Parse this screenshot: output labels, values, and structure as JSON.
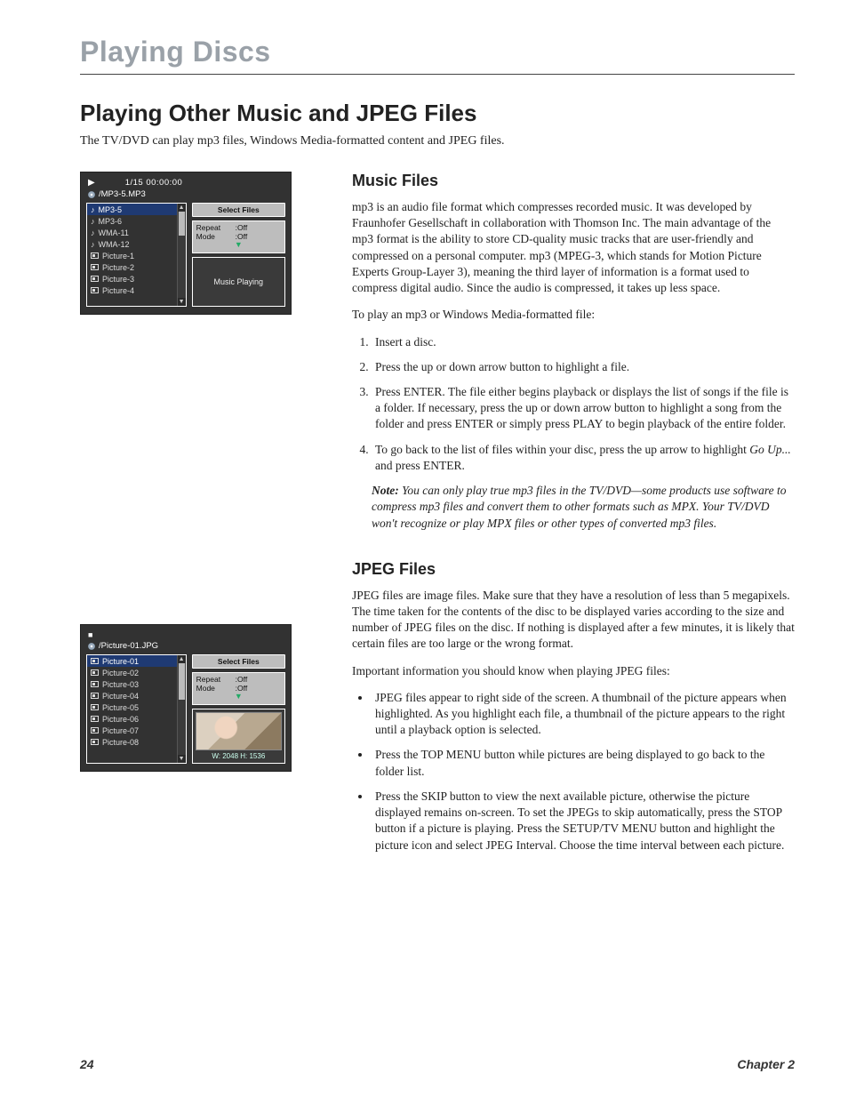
{
  "chapterHeader": "Playing Discs",
  "sectionTitle": "Playing Other Music and JPEG Files",
  "intro": "The TV/DVD can play mp3 files, Windows Media-formatted content and JPEG files.",
  "music": {
    "heading": "Music Files",
    "p1": "mp3 is an audio file format which compresses recorded music. It was developed by Fraunhofer Gesellschaft in collaboration with Thomson Inc. The main advantage of the mp3 format is the ability to store CD-quality music tracks that are user-friendly and compressed on a personal computer. mp3 (MPEG-3, which stands for Motion Picture Experts Group-Layer 3), meaning the third layer of information is a format used to compress digital audio. Since the audio is compressed, it takes up less space.",
    "p2": "To play an mp3 or Windows Media-formatted file:",
    "steps": [
      "Insert a disc.",
      "Press the up or down arrow button to highlight a file.",
      "Press ENTER. The file either begins playback or displays the list of songs if the file is a folder. If necessary, press the up or down arrow button to highlight a song from the folder and press ENTER or simply press PLAY to begin playback of the entire folder.",
      "To go back to the list of files within your disc, press the up arrow to highlight Go Up... and press ENTER."
    ],
    "noteLabel": "Note:",
    "note": "You can only play true mp3 files in the TV/DVD—some products use software to compress mp3 files and convert them to other formats such as MPX. Your TV/DVD won't recognize or play MPX files or other types of converted mp3 files."
  },
  "jpeg": {
    "heading": "JPEG Files",
    "p1": "JPEG files are image files. Make sure that they have a resolution of less than 5 megapixels. The time taken for the contents of the disc to be displayed varies according to the size and number of JPEG files on the disc. If nothing is displayed after a few minutes, it is likely that certain files are too large or the wrong format.",
    "p2": "Important information you should know when playing JPEG files:",
    "bullets": [
      "JPEG files appear to right side of the screen. A thumbnail of the picture appears when highlighted. As you highlight each file, a thumbnail of the picture appears to the right until a playback option is selected.",
      "Press the TOP MENU button while pictures are being displayed to go back to the folder list.",
      "Press the SKIP button to view the next available picture, otherwise the picture displayed remains on-screen. To set the JPEGs to skip automatically, press the STOP button if a picture is playing. Press the SETUP/TV MENU button and highlight the picture icon and select JPEG Interval. Choose the time interval between each picture."
    ]
  },
  "osd1": {
    "counter": "1/15  00:00:00",
    "path": "/MP3-5.MP3",
    "files": [
      {
        "label": "MP3-5",
        "type": "music",
        "sel": true
      },
      {
        "label": "MP3-6",
        "type": "music"
      },
      {
        "label": "WMA-11",
        "type": "music"
      },
      {
        "label": "WMA-12",
        "type": "music"
      },
      {
        "label": "Picture-1",
        "type": "pic"
      },
      {
        "label": "Picture-2",
        "type": "pic"
      },
      {
        "label": "Picture-3",
        "type": "pic"
      },
      {
        "label": "Picture-4",
        "type": "pic"
      }
    ],
    "selectFiles": "Select Files",
    "repeatLabel": "Repeat",
    "repeatValue": ":Off",
    "modeLabel": "Mode",
    "modeValue": ":Off",
    "status": "Music Playing"
  },
  "osd2": {
    "path": "/Picture-01.JPG",
    "files": [
      {
        "label": "Picture-01",
        "type": "pic",
        "sel": true
      },
      {
        "label": "Picture-02",
        "type": "pic"
      },
      {
        "label": "Picture-03",
        "type": "pic"
      },
      {
        "label": "Picture-04",
        "type": "pic"
      },
      {
        "label": "Picture-05",
        "type": "pic"
      },
      {
        "label": "Picture-06",
        "type": "pic"
      },
      {
        "label": "Picture-07",
        "type": "pic"
      },
      {
        "label": "Picture-08",
        "type": "pic"
      }
    ],
    "selectFiles": "Select Files",
    "repeatLabel": "Repeat",
    "repeatValue": ":Off",
    "modeLabel": "Mode",
    "modeValue": ":Off",
    "dims": "W: 2048   H: 1536"
  },
  "footer": {
    "page": "24",
    "chapter": "Chapter 2"
  }
}
